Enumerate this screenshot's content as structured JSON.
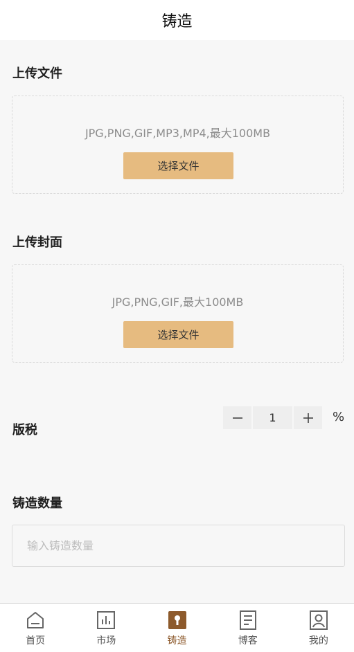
{
  "header": {
    "title": "铸造"
  },
  "upload_file": {
    "title": "上传文件",
    "hint": "JPG,PNG,GIF,MP3,MP4,最大100MB",
    "button_label": "选择文件"
  },
  "upload_cover": {
    "title": "上传封面",
    "hint": "JPG,PNG,GIF,最大100MB",
    "button_label": "选择文件"
  },
  "royalty": {
    "label": "版税",
    "value": "1",
    "unit": "%"
  },
  "mint_quantity": {
    "label": "铸造数量",
    "placeholder": "输入铸造数量",
    "value": ""
  },
  "tabbar": {
    "items": [
      {
        "label": "首页",
        "icon": "home-icon",
        "active": false
      },
      {
        "label": "市场",
        "icon": "chart-icon",
        "active": false
      },
      {
        "label": "铸造",
        "icon": "mint-icon",
        "active": true
      },
      {
        "label": "博客",
        "icon": "document-icon",
        "active": false
      },
      {
        "label": "我的",
        "icon": "profile-icon",
        "active": false
      }
    ]
  },
  "colors": {
    "accent_button": "#e6bb80",
    "active_tab": "#8d5a2c",
    "background": "#f7f7f7"
  }
}
